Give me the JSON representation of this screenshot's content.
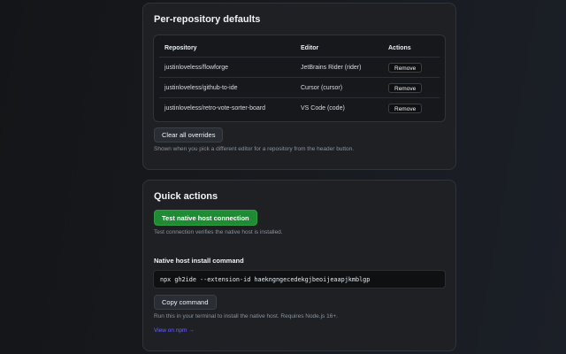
{
  "defaults_section": {
    "title": "Per-repository defaults",
    "table": {
      "headers": [
        "Repository",
        "Editor",
        "Actions"
      ],
      "rows": [
        {
          "repository": "justinloveless/flowforge",
          "editor": "JetBrains Rider (rider)",
          "action": "Remove"
        },
        {
          "repository": "justinloveless/github-to-ide",
          "editor": "Cursor (cursor)",
          "action": "Remove"
        },
        {
          "repository": "justinloveless/retro-vote-sorter-board",
          "editor": "VS Code (code)",
          "action": "Remove"
        }
      ]
    },
    "clear_button": "Clear all overrides",
    "hint": "Shown when you pick a different editor for a repository from the header button."
  },
  "quick_actions": {
    "title": "Quick actions",
    "test_button": "Test native host connection",
    "test_hint": "Test connection verifies the native host is installed.",
    "install_title": "Native host install command",
    "command": "npx gh2ide --extension-id haekngngecedekgjbeoijeaapjkmblgp",
    "copy_button": "Copy command",
    "copy_hint": "Run this in your terminal to install the native host. Requires Node.js 16+.",
    "npm_link": "View on npm →"
  },
  "colors": {
    "background": "#16181c",
    "card": "#1e2024",
    "primary": "#1f8b34",
    "link": "#6f63ff"
  }
}
